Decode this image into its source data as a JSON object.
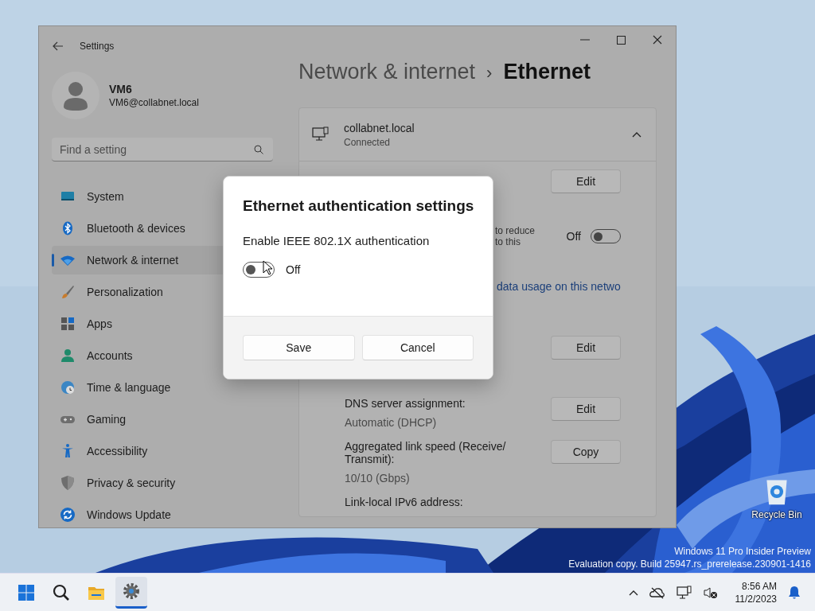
{
  "window": {
    "title": "Settings"
  },
  "profile": {
    "name": "VM6",
    "email": "VM6@collabnet.local"
  },
  "search": {
    "placeholder": "Find a setting"
  },
  "nav": [
    {
      "kind": "system",
      "label": "System",
      "selected": false
    },
    {
      "kind": "bluetooth",
      "label": "Bluetooth & devices",
      "selected": false
    },
    {
      "kind": "network",
      "label": "Network & internet",
      "selected": true
    },
    {
      "kind": "personalization",
      "label": "Personalization",
      "selected": false
    },
    {
      "kind": "apps",
      "label": "Apps",
      "selected": false
    },
    {
      "kind": "accounts",
      "label": "Accounts",
      "selected": false
    },
    {
      "kind": "time",
      "label": "Time & language",
      "selected": false
    },
    {
      "kind": "gaming",
      "label": "Gaming",
      "selected": false
    },
    {
      "kind": "accessibility",
      "label": "Accessibility",
      "selected": false
    },
    {
      "kind": "privacy",
      "label": "Privacy & security",
      "selected": false
    },
    {
      "kind": "update",
      "label": "Windows Update",
      "selected": false
    }
  ],
  "breadcrumb": {
    "parent": "Network & internet",
    "separator": "›",
    "current": "Ethernet"
  },
  "adapter": {
    "name": "collabnet.local",
    "status": "Connected",
    "expanded": true
  },
  "rows": [
    {
      "kind": "button",
      "button": "Edit"
    },
    {
      "kind": "toggle",
      "fragments": [
        "to reduce",
        "to this"
      ],
      "state_label": "Off",
      "on": false
    },
    {
      "kind": "link",
      "text": "data usage on this netwo"
    },
    {
      "kind": "button",
      "button": "Edit"
    },
    {
      "kind": "property",
      "label": "DNS server assignment:",
      "value": "Automatic (DHCP)",
      "button": "Edit"
    },
    {
      "kind": "property",
      "label": "Aggregated link speed (Receive/ Transmit):",
      "value": "10/10 (Gbps)",
      "button": "Copy"
    },
    {
      "kind": "property",
      "label": "Link-local IPv6 address:"
    }
  ],
  "dialog": {
    "title": "Ethernet authentication settings",
    "option": "Enable IEEE 802.1X authentication",
    "toggle": {
      "on": false,
      "label": "Off"
    },
    "buttons": [
      "Save",
      "Cancel"
    ]
  },
  "desktop": {
    "icons": [
      {
        "label": "Recycle Bin"
      }
    ],
    "watermark": [
      "Windows 11 Pro Insider Preview",
      "Evaluation copy. Build 25947.rs_prerelease.230901-1416"
    ]
  },
  "taskbar": {
    "apps": [
      {
        "kind": "start",
        "selected": false
      },
      {
        "kind": "search",
        "selected": false
      },
      {
        "kind": "explorer",
        "selected": false
      },
      {
        "kind": "settings",
        "selected": true
      }
    ],
    "clock": {
      "time": "8:56 AM",
      "date": "11/2/2023"
    }
  }
}
